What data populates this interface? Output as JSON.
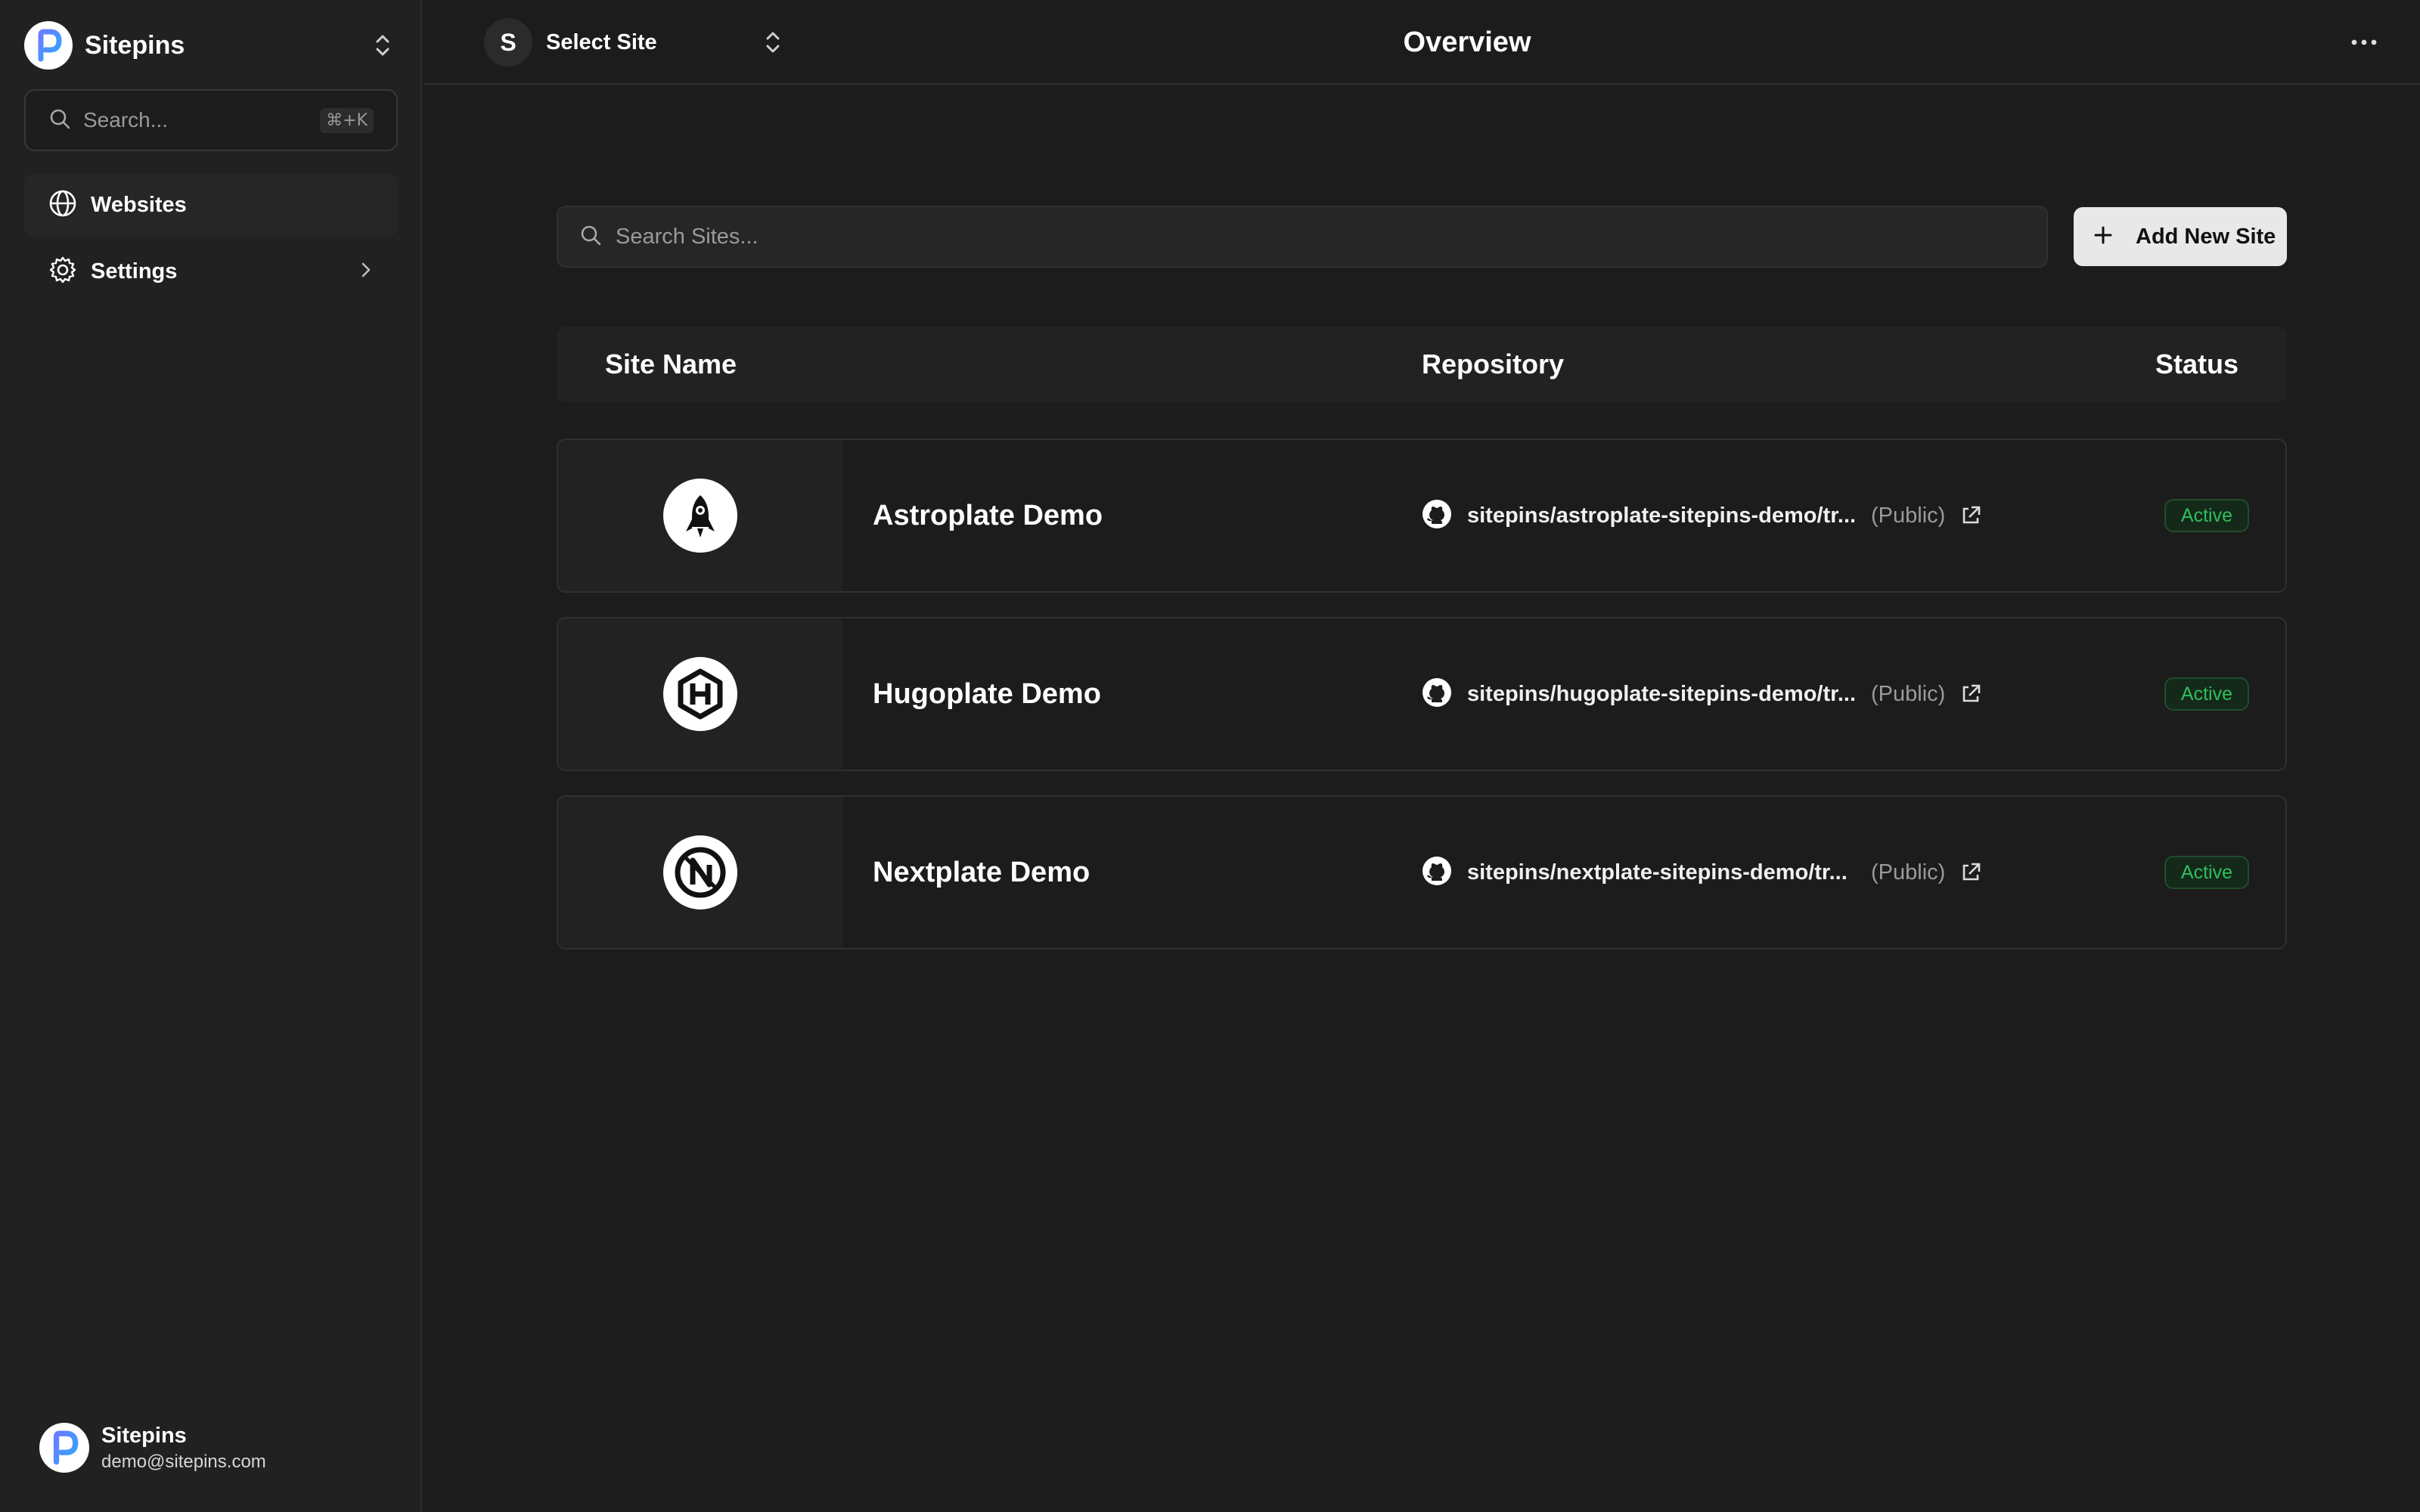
{
  "sidebar": {
    "brand": {
      "name": "Sitepins"
    },
    "search": {
      "placeholder": "Search...",
      "shortcut": "⌘+K"
    },
    "nav": [
      {
        "label": "Websites",
        "icon": "globe-icon",
        "active": true
      },
      {
        "label": "Settings",
        "icon": "gear-icon",
        "has_submenu": true
      }
    ],
    "user": {
      "name": "Sitepins",
      "email": "demo@sitepins.com"
    }
  },
  "topbar": {
    "site_select": {
      "avatar_letter": "S",
      "label": "Select Site"
    },
    "title": "Overview"
  },
  "main": {
    "search_placeholder": "Search Sites...",
    "add_button": "Add New Site",
    "columns": [
      "Site Name",
      "Repository",
      "Status"
    ],
    "sites": [
      {
        "name": "Astroplate Demo",
        "logo": "rocket-icon",
        "repo": "sitepins/astroplate-sitepins-demo/tr...",
        "visibility": "(Public)",
        "status": "Active"
      },
      {
        "name": "Hugoplate Demo",
        "logo": "hugo-hexagon-icon",
        "repo": "sitepins/hugoplate-sitepins-demo/tr...",
        "visibility": "(Public)",
        "status": "Active"
      },
      {
        "name": "Nextplate Demo",
        "logo": "nextplate-n-icon",
        "repo": "sitepins/nextplate-sitepins-demo/tr...",
        "visibility": "(Public)",
        "status": "Active"
      }
    ]
  },
  "colors": {
    "background": "#1c1c1c",
    "sidebar": "#212121",
    "status_active": "#2fbf5a",
    "brand_gradient": [
      "#6d7cff",
      "#2ba8ff"
    ]
  }
}
